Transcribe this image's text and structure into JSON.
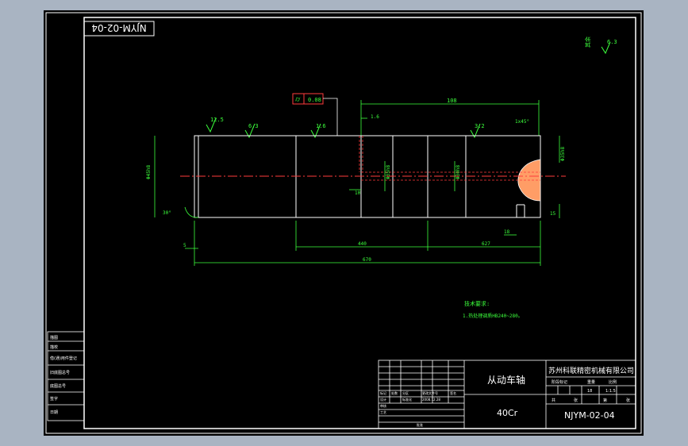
{
  "drawing_number_rotated": "NJYM-02-04",
  "surface": {
    "overall": "6.3"
  },
  "tolerance_frame": {
    "symbol": "⌭",
    "value": "0.08"
  },
  "roughness": [
    "12.5",
    "6.3",
    "1.6",
    "3.2"
  ],
  "dimensions": {
    "top_length": "108",
    "small_step": "1.6",
    "chamfer": "1x45°",
    "left_dia": "Φ45h8",
    "right_dia_a": "Φ35h8",
    "right_dia_b": "Φ30h8",
    "right_end_dia": "Φ35h8",
    "angle": "30°",
    "left_offset": "5",
    "len_a": "440",
    "len_b": "627",
    "total": "670",
    "key_w": "18",
    "key_h": "15",
    "key_depth": "10"
  },
  "notes": {
    "title": "技术要求:",
    "item1": "1.热处理调质HB240~280。"
  },
  "title_block": {
    "part_name": "从动车轴",
    "material": "40Cr",
    "company": "苏州科联精密机械有限公司",
    "drawing_no": "NJYM-02-04",
    "scale": "1:1.5",
    "qty": "18",
    "row_labels": [
      "标记",
      "处数",
      "分区",
      "更改文件号",
      "签名",
      "年月日"
    ],
    "row2": [
      "设计",
      "",
      "标准化",
      "2008.12.28"
    ],
    "audit": "审核",
    "process": "工艺",
    "approve": "批准",
    "stage_label": "阶段标记",
    "weight_label": "重量",
    "scale_label": "比例",
    "sheet_labels": [
      "共",
      "张",
      "第",
      "张"
    ]
  },
  "side_block": [
    "借(通)用件登记",
    "旧底图总号",
    "底图总号",
    "签字",
    "日期",
    "描图",
    "描校"
  ]
}
